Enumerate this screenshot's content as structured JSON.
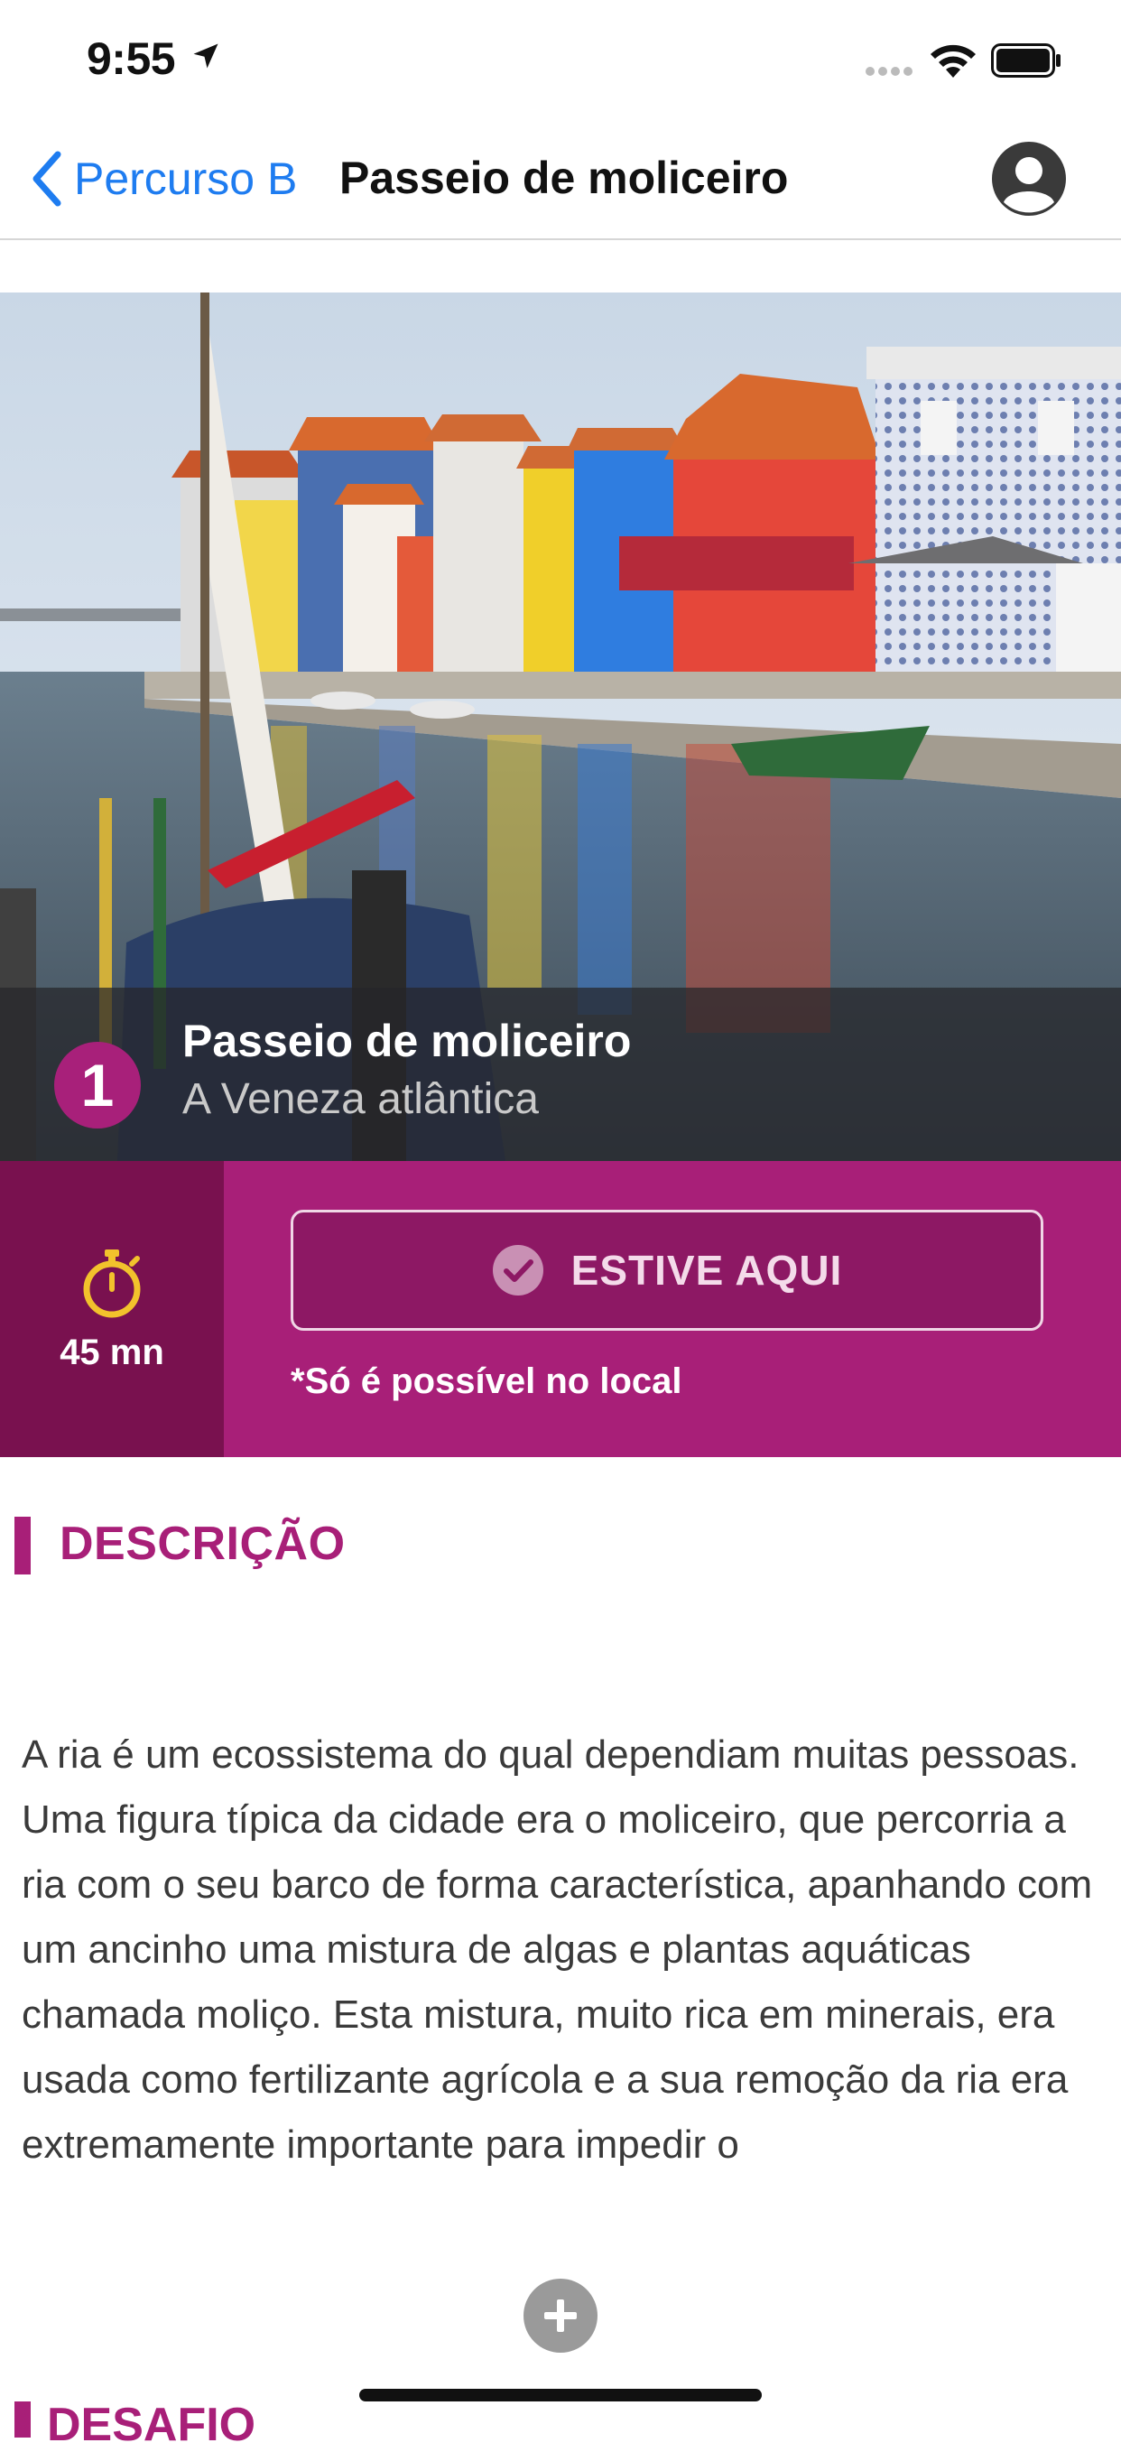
{
  "status_bar": {
    "time": "9:55"
  },
  "nav": {
    "back_label": "Percurso B",
    "title": "Passeio de moliceiro"
  },
  "hero": {
    "number": "1",
    "title": "Passeio de moliceiro",
    "subtitle": "A Veneza atlântica"
  },
  "action": {
    "duration": "45 mn",
    "button_label": "ESTIVE AQUI",
    "note": "*Só é possível no local"
  },
  "description": {
    "heading": "DESCRIÇÃO",
    "text": "A ria é um ecossistema do qual dependiam muitas pessoas. Uma figura típica da cidade era o moliceiro, que percorria a ria com o seu barco de forma característica, apanhando com um ancinho uma mistura de algas e plantas aquáticas chamada moliço. Esta mistura, muito rica em minerais, era usada como fertilizante agrícola e a sua remoção da ria era extremamente importante para impedir o"
  },
  "next_section": {
    "heading": "DESAFIO"
  },
  "colors": {
    "accent": "#a81f78",
    "accent_dark": "#79114f",
    "link_blue": "#1e7cf0",
    "timer_yellow": "#f2c22c"
  }
}
